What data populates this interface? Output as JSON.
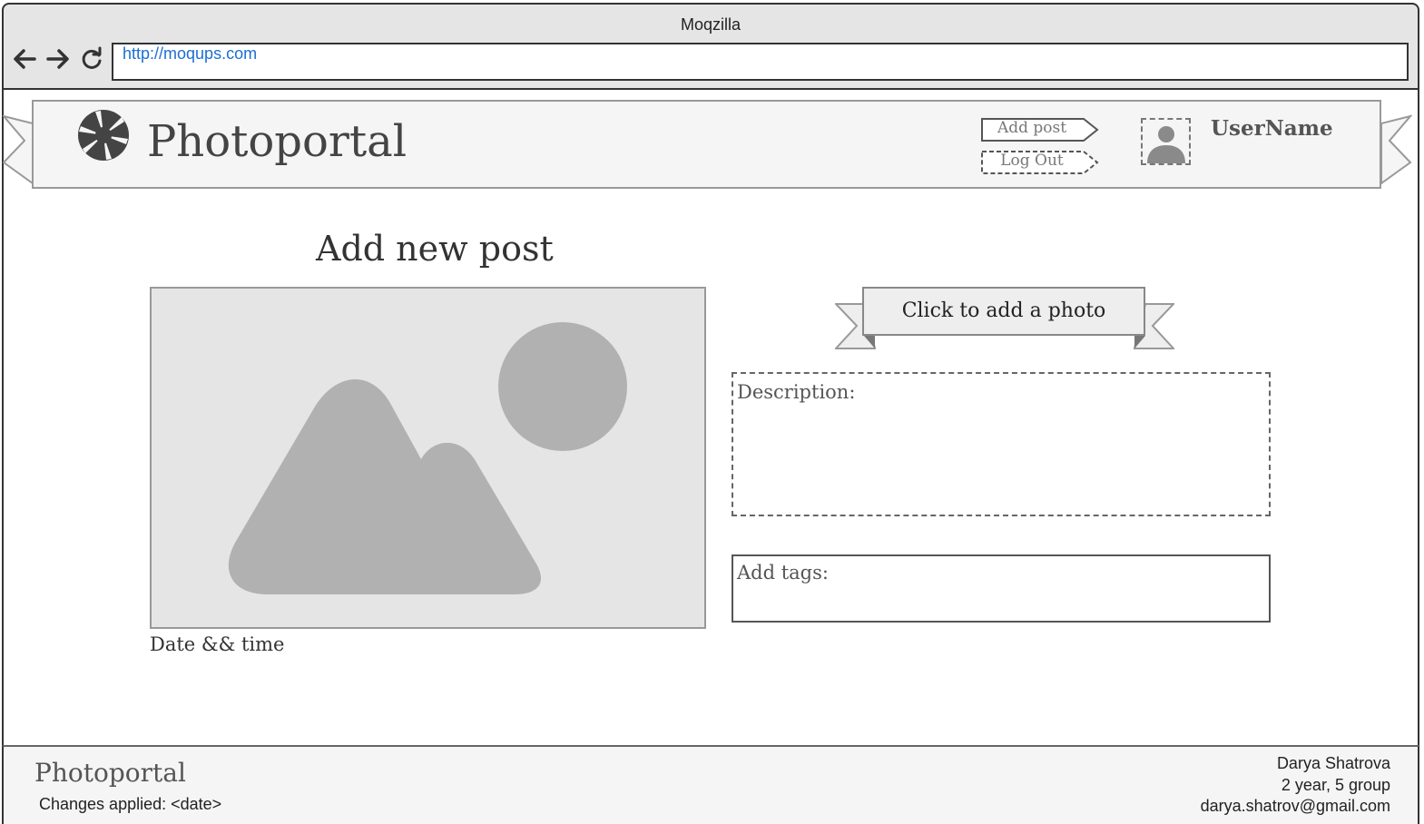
{
  "browser": {
    "title": "Moqzilla",
    "url": "http://moqups.com",
    "back_icon": "arrow-left-icon",
    "forward_icon": "arrow-right-icon",
    "reload_icon": "reload-icon"
  },
  "header": {
    "logo_icon": "camera-aperture-icon",
    "site_title": "Photoportal",
    "add_post_label": "Add post",
    "logout_label": "Log Out",
    "avatar_icon": "user-avatar-icon",
    "username": "UserName"
  },
  "main": {
    "heading": "Add new post",
    "photo_icon": "image-placeholder-icon",
    "datetime": "Date && time",
    "add_photo_label": "Click to add a photo",
    "description_label": "Description:",
    "tags_label": "Add tags:"
  },
  "footer": {
    "title": "Photoportal",
    "changes": "Changes applied: <date>",
    "author": "Darya Shatrova",
    "group": "2 year, 5 group",
    "email": "darya.shatrov@gmail.com"
  },
  "colors": {
    "url_text": "#1a6fd1",
    "header_bg": "#f5f5f5",
    "placeholder_bg": "#e5e5e5",
    "placeholder_shape": "#b1b1b1"
  }
}
